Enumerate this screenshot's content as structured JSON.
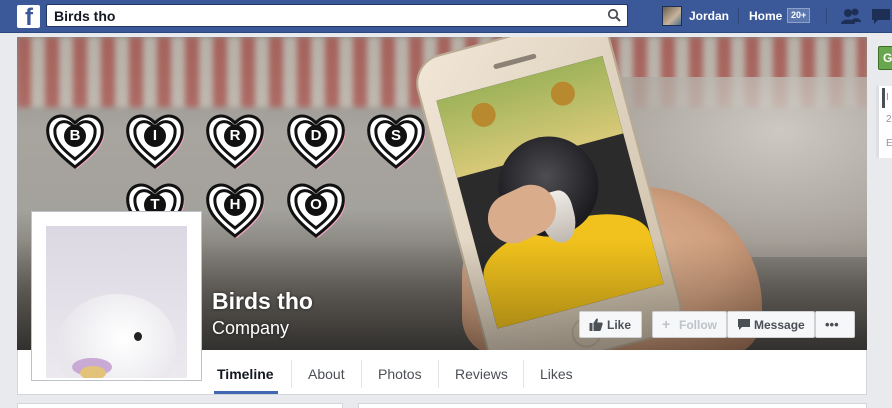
{
  "topbar": {
    "search_value": "Birds tho",
    "user_name": "Jordan",
    "home_label": "Home",
    "home_badge": "20+"
  },
  "page": {
    "name": "Birds tho",
    "category": "Company",
    "cover_letters": [
      "B",
      "I",
      "R",
      "D",
      "S",
      "T",
      "H",
      "O"
    ]
  },
  "actions": {
    "like": "Like",
    "follow": "Follow",
    "message": "Message",
    "more": "•••"
  },
  "tabs": [
    {
      "label": "Timeline",
      "active": true
    },
    {
      "label": "About"
    },
    {
      "label": "Photos"
    },
    {
      "label": "Reviews"
    },
    {
      "label": "Likes"
    }
  ],
  "side_panel": {
    "button_label": "G",
    "lines": [
      "I",
      "2",
      "E"
    ]
  },
  "colors": {
    "brand": "#3b5998",
    "heart_pink": "#f0a0bf",
    "green": "#69a74e"
  }
}
